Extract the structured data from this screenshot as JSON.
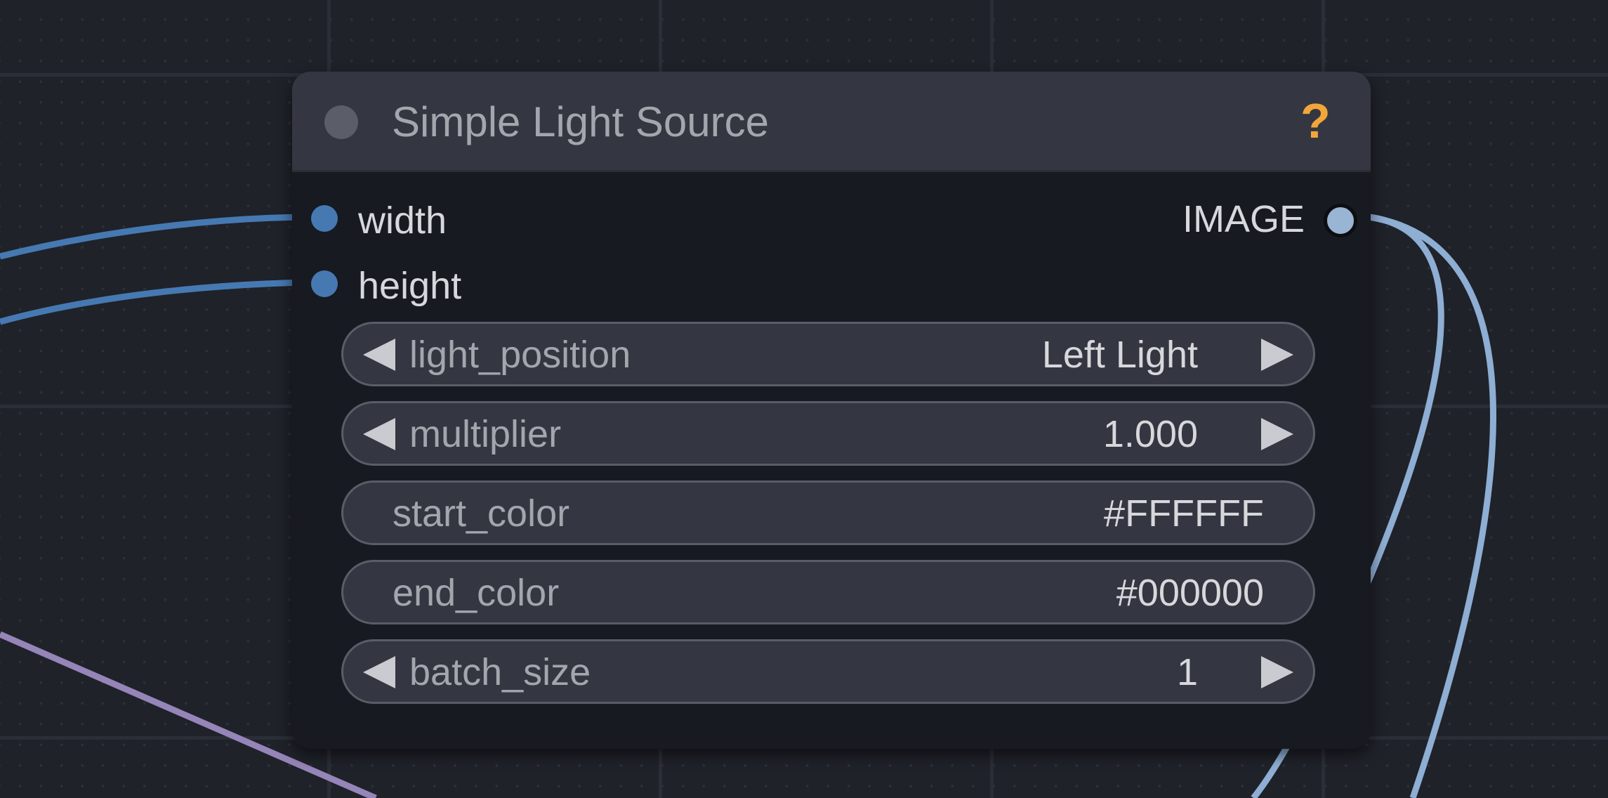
{
  "node": {
    "title": "Simple Light Source",
    "help_symbol": "?",
    "inputs": [
      {
        "label": "width"
      },
      {
        "label": "height"
      }
    ],
    "output": {
      "label": "IMAGE"
    },
    "widgets": {
      "light_position": {
        "label": "light_position",
        "value": "Left Light"
      },
      "multiplier": {
        "label": "multiplier",
        "value": "1.000"
      },
      "start_color": {
        "label": "start_color",
        "value": "#FFFFFF"
      },
      "end_color": {
        "label": "end_color",
        "value": "#000000"
      },
      "batch_size": {
        "label": "batch_size",
        "value": "1"
      }
    }
  },
  "colors": {
    "canvas": "#1f2229",
    "node_body": "#171a21",
    "node_header": "#343741",
    "input_slot": "#4679b2",
    "image_link": "#8eaed3",
    "purple_link": "#9585b8",
    "help_icon": "#f2a63a"
  }
}
